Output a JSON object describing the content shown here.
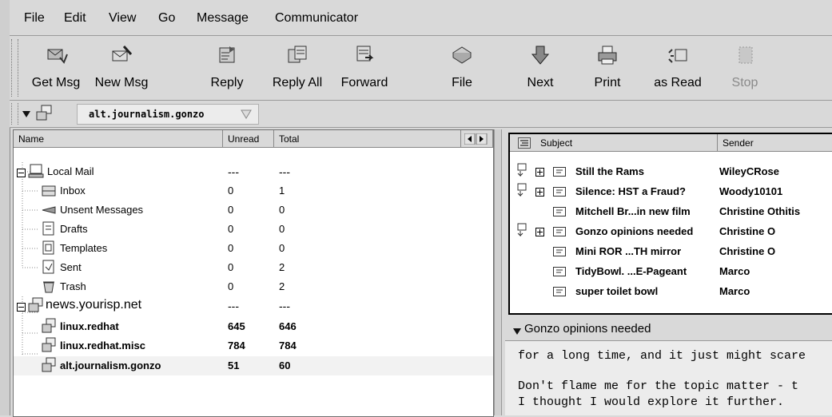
{
  "menu": [
    "File",
    "Edit",
    "View",
    "Go",
    "Message",
    "Communicator"
  ],
  "toolbar": {
    "get_msg": "Get Msg",
    "new_msg": "New Msg",
    "reply": "Reply",
    "reply_all": "Reply All",
    "forward": "Forward",
    "file": "File",
    "next": "Next",
    "print": "Print",
    "as_read": "as Read",
    "stop": "Stop"
  },
  "location": {
    "folder": "alt.journalism.gonzo"
  },
  "folder_list": {
    "headers": {
      "name": "Name",
      "unread": "Unread",
      "total": "Total"
    },
    "rows": [
      {
        "name": "Local Mail",
        "unread": "---",
        "total": "---"
      },
      {
        "name": "Inbox",
        "unread": "0",
        "total": "1"
      },
      {
        "name": "Unsent Messages",
        "unread": "0",
        "total": "0"
      },
      {
        "name": "Drafts",
        "unread": "0",
        "total": "0"
      },
      {
        "name": "Templates",
        "unread": "0",
        "total": "0"
      },
      {
        "name": "Sent",
        "unread": "0",
        "total": "2"
      },
      {
        "name": "Trash",
        "unread": "0",
        "total": "2"
      },
      {
        "name": "news.yourisp.net",
        "unread": "---",
        "total": "---"
      },
      {
        "name": "linux.redhat",
        "unread": "645",
        "total": "646"
      },
      {
        "name": "linux.redhat.misc",
        "unread": "784",
        "total": "784"
      },
      {
        "name": "alt.journalism.gonzo",
        "unread": "51",
        "total": "60"
      }
    ]
  },
  "message_list": {
    "headers": {
      "subject": "Subject",
      "sender": "Sender"
    },
    "rows": [
      {
        "subject": "Still the Rams",
        "sender": "WileyCRose"
      },
      {
        "subject": "Silence: HST a Fraud?",
        "sender": "Woody10101"
      },
      {
        "subject": "Mitchell Br...in new film",
        "sender": "Christine Othitis"
      },
      {
        "subject": "Gonzo opinions needed",
        "sender": "Christine O"
      },
      {
        "subject": "Mini ROR ...TH mirror",
        "sender": "Christine O"
      },
      {
        "subject": "TidyBowl. ...E-Pageant",
        "sender": "Marco"
      },
      {
        "subject": "super toilet bowl",
        "sender": "Marco"
      }
    ]
  },
  "preview": {
    "title": "Gonzo opinions needed",
    "lines": [
      "for a long time, and it just might scare",
      "Don't flame me for the topic matter - t",
      "I thought I would explore it further."
    ]
  }
}
